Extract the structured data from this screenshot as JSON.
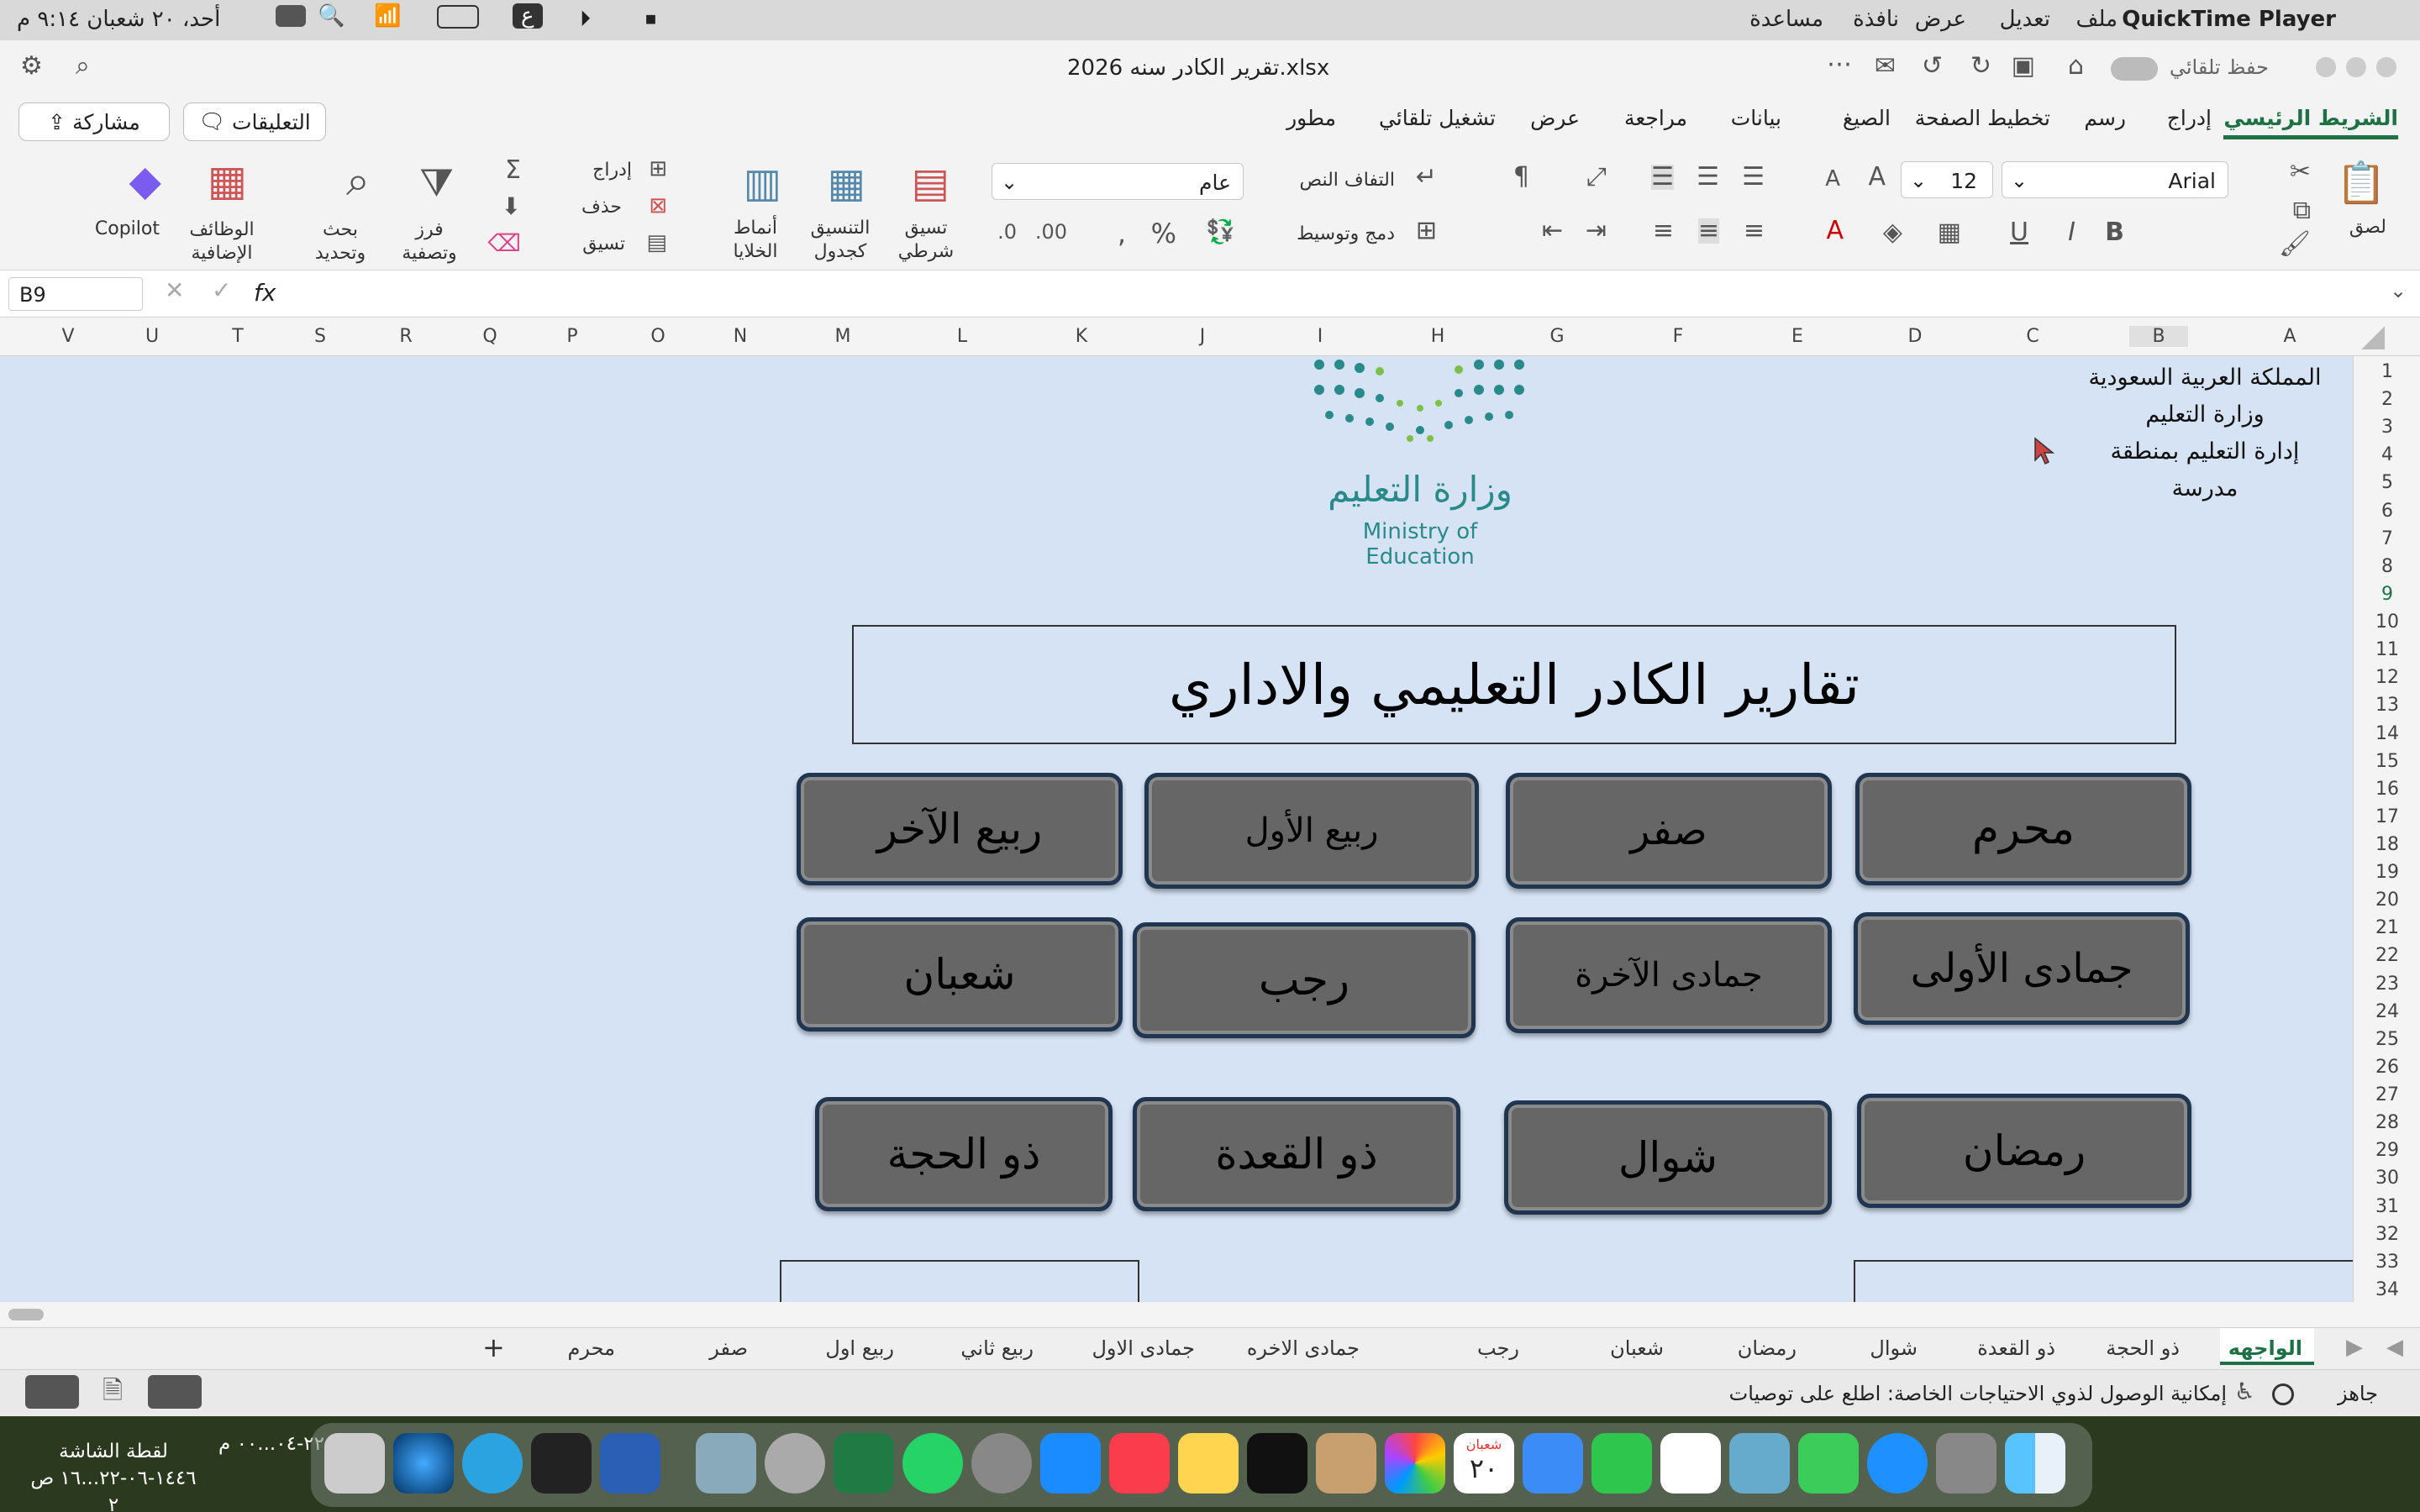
{
  "menubar": {
    "app": "QuickTime Player",
    "items": [
      "ملف",
      "تعديل",
      "عرض",
      "نافذة",
      "مساعدة"
    ],
    "clock": "أحد، ٢٠ شعبان ٩:١٤ م",
    "input_lang": "ع"
  },
  "titlebar": {
    "document_title": "تقرير الكادر سنه 2026.xlsx",
    "autosave_label": "حفظ تلقائي"
  },
  "ribbon_tabs": [
    "الشريط الرئيسي",
    "إدراج",
    "رسم",
    "تخطيط الصفحة",
    "الصيغ",
    "بيانات",
    "مراجعة",
    "عرض",
    "تشغيل تلقائي",
    "مطور"
  ],
  "share_button": "مشاركة",
  "comments_button": "التعليقات",
  "ribbon": {
    "font_name": "Arial",
    "font_size": "12",
    "number_format": "عام",
    "paste": "لصق",
    "wrap_text": "التفاف النص",
    "merge_center": "دمج وتوسيط",
    "conditional_formatting": "تسيق شرطي",
    "format_as_table": "التنسيق كجدول",
    "cell_styles": "أنماط الخلايا",
    "insert": "إدراج",
    "delete": "حذف",
    "format": "تسيق",
    "sort_filter": "فرز وتصفية",
    "find_select": "بحث وتحديد",
    "addins": "الوظائف الإضافية",
    "copilot": "Copilot"
  },
  "formula_bar": {
    "name_box": "B9",
    "fx": "fx",
    "content": ""
  },
  "columns": [
    "A",
    "B",
    "C",
    "D",
    "E",
    "F",
    "G",
    "H",
    "I",
    "J",
    "K",
    "L",
    "M",
    "N",
    "O",
    "P",
    "Q",
    "R",
    "S",
    "T",
    "U",
    "V"
  ],
  "rows": [
    "1",
    "2",
    "3",
    "4",
    "5",
    "6",
    "7",
    "8",
    "9",
    "10",
    "11",
    "12",
    "13",
    "14",
    "15",
    "16",
    "17",
    "18",
    "19",
    "20",
    "21",
    "22",
    "23",
    "24",
    "25",
    "26",
    "27",
    "28",
    "29",
    "30",
    "31",
    "32",
    "33",
    "34"
  ],
  "header_lines": [
    "المملكة العربية السعودية",
    "وزارة التعليم",
    "إدارة التعليم بمنطقة",
    "مدرسة"
  ],
  "logo": {
    "arabic": "وزارة التعليم",
    "english": "Ministry of Education"
  },
  "main_title": "تقارير الكادر التعليمي والاداري",
  "month_buttons": [
    "محرم",
    "صفر",
    "ربيع الأول",
    "ربيع الآخر",
    "جمادى الأولى",
    "جمادى الآخرة",
    "رجب",
    "شعبان",
    "رمضان",
    "شوال",
    "ذو القعدة",
    "ذو الحجة"
  ],
  "sheet_tabs": [
    "الواجهه",
    "ذو الحجة",
    "ذو القعدة",
    "شوال",
    "رمضان",
    "شعبان",
    "رجب",
    "جمادى الاخره",
    "جمادى الاول",
    "ربيع ثاني",
    "ربيع اول",
    "صفر",
    "محرم"
  ],
  "add_sheet": "+",
  "status": {
    "ready": "جاهز",
    "accessibility": "إمكانية الوصول لذوي الاحتياجات الخاصة: اطلع على توصيات"
  },
  "desktop": {
    "screenshot_label": "لقطة الشاشة",
    "screenshot_sub": "١٤٤٦-٠٦-٢٢...١٦ ص ٢",
    "screenshot_label2": "٢٢-٠٤...٠٠ م"
  },
  "calendar_dock": {
    "month": "شعبان",
    "day": "٢٠"
  },
  "colors": {
    "accent": "#1e7145",
    "sheet_bg": "#d6e3f4",
    "button_fill": "#666666",
    "button_border": "#1f3550"
  }
}
